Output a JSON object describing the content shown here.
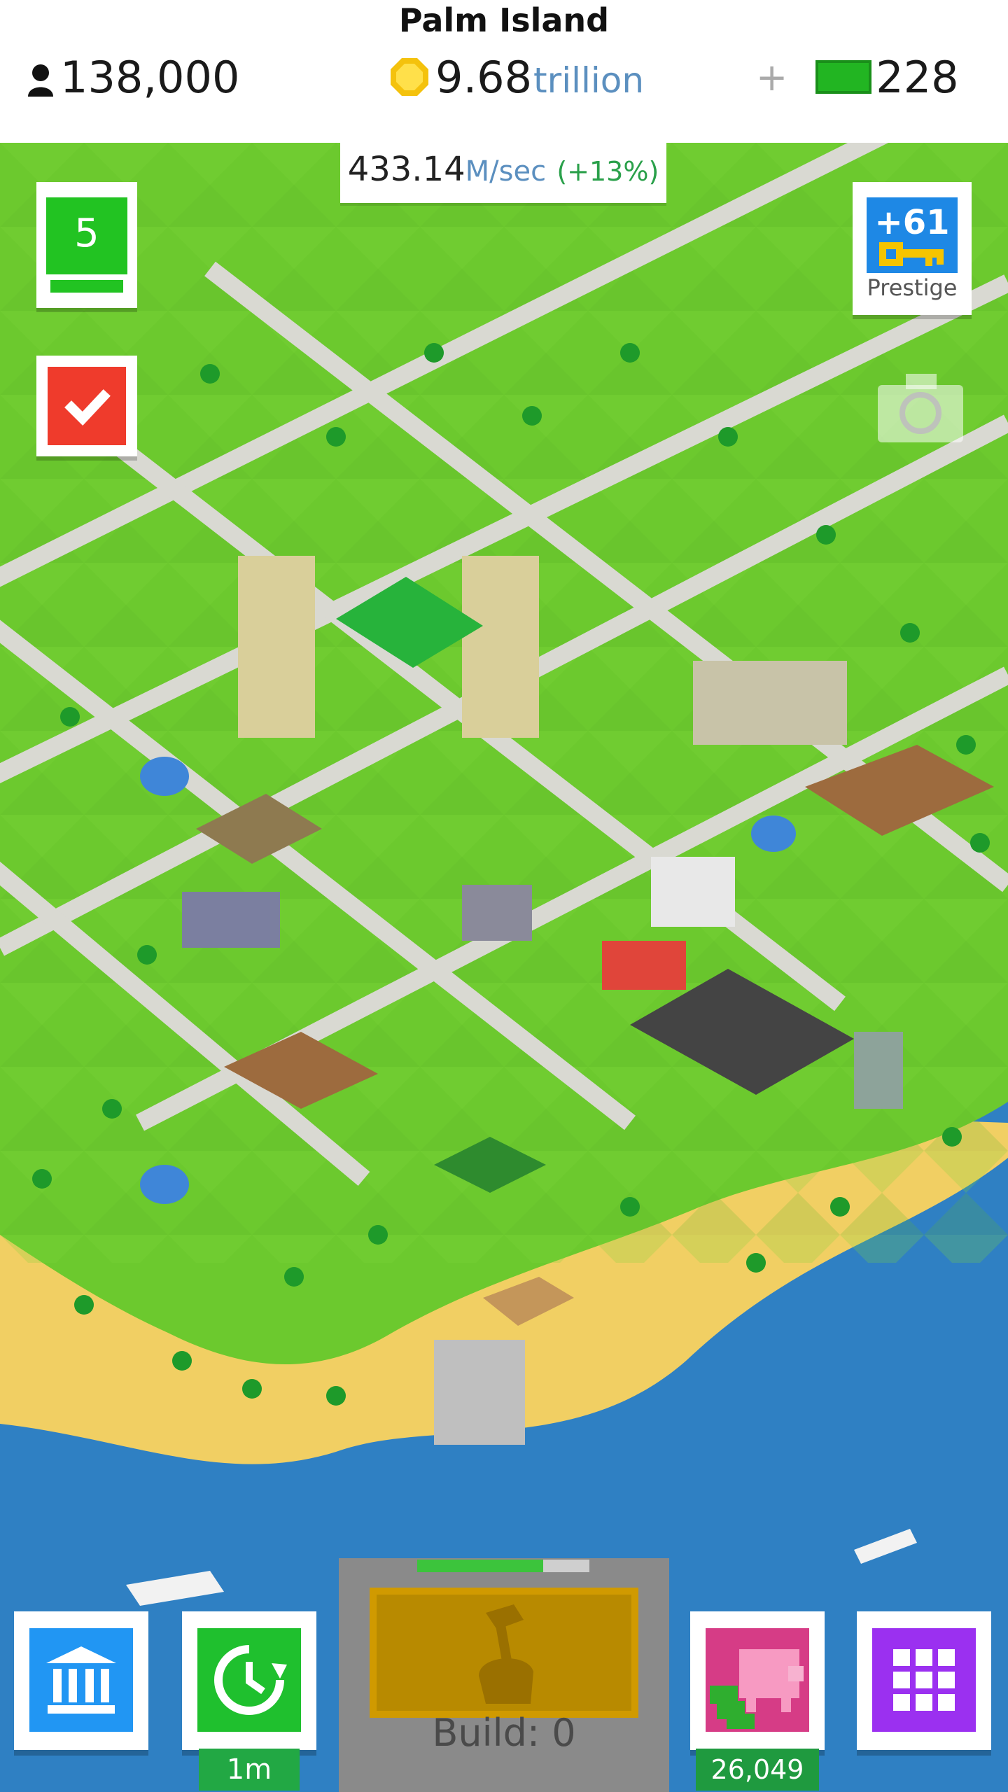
{
  "header": {
    "island_name": "Palm Island",
    "population": "138,000",
    "coins": "9.68",
    "coins_unit": "trillion",
    "cash_plus": "+",
    "cash": "228"
  },
  "income": {
    "value": "433.14",
    "unit": "M/sec",
    "percent": "(+13%)"
  },
  "level_badge": {
    "value": "5"
  },
  "prestige": {
    "value": "+61",
    "label": "Prestige"
  },
  "bottom_bar": {
    "timer_label": "1m",
    "piggy_value": "26,049",
    "build_label": "Build: 0",
    "build_progress": 0.73
  },
  "icons": [
    "person-icon",
    "coin-icon",
    "cash-icon",
    "check-icon",
    "key-icon",
    "camera-icon",
    "bank-icon",
    "timer-icon",
    "hammer-icon",
    "piggy-bank-icon",
    "grid-icon"
  ],
  "colors": {
    "green": "#22c322",
    "red": "#ef3b2c",
    "blue": "#1e88e5",
    "purple": "#9b30f0",
    "pink": "#d63c86"
  }
}
